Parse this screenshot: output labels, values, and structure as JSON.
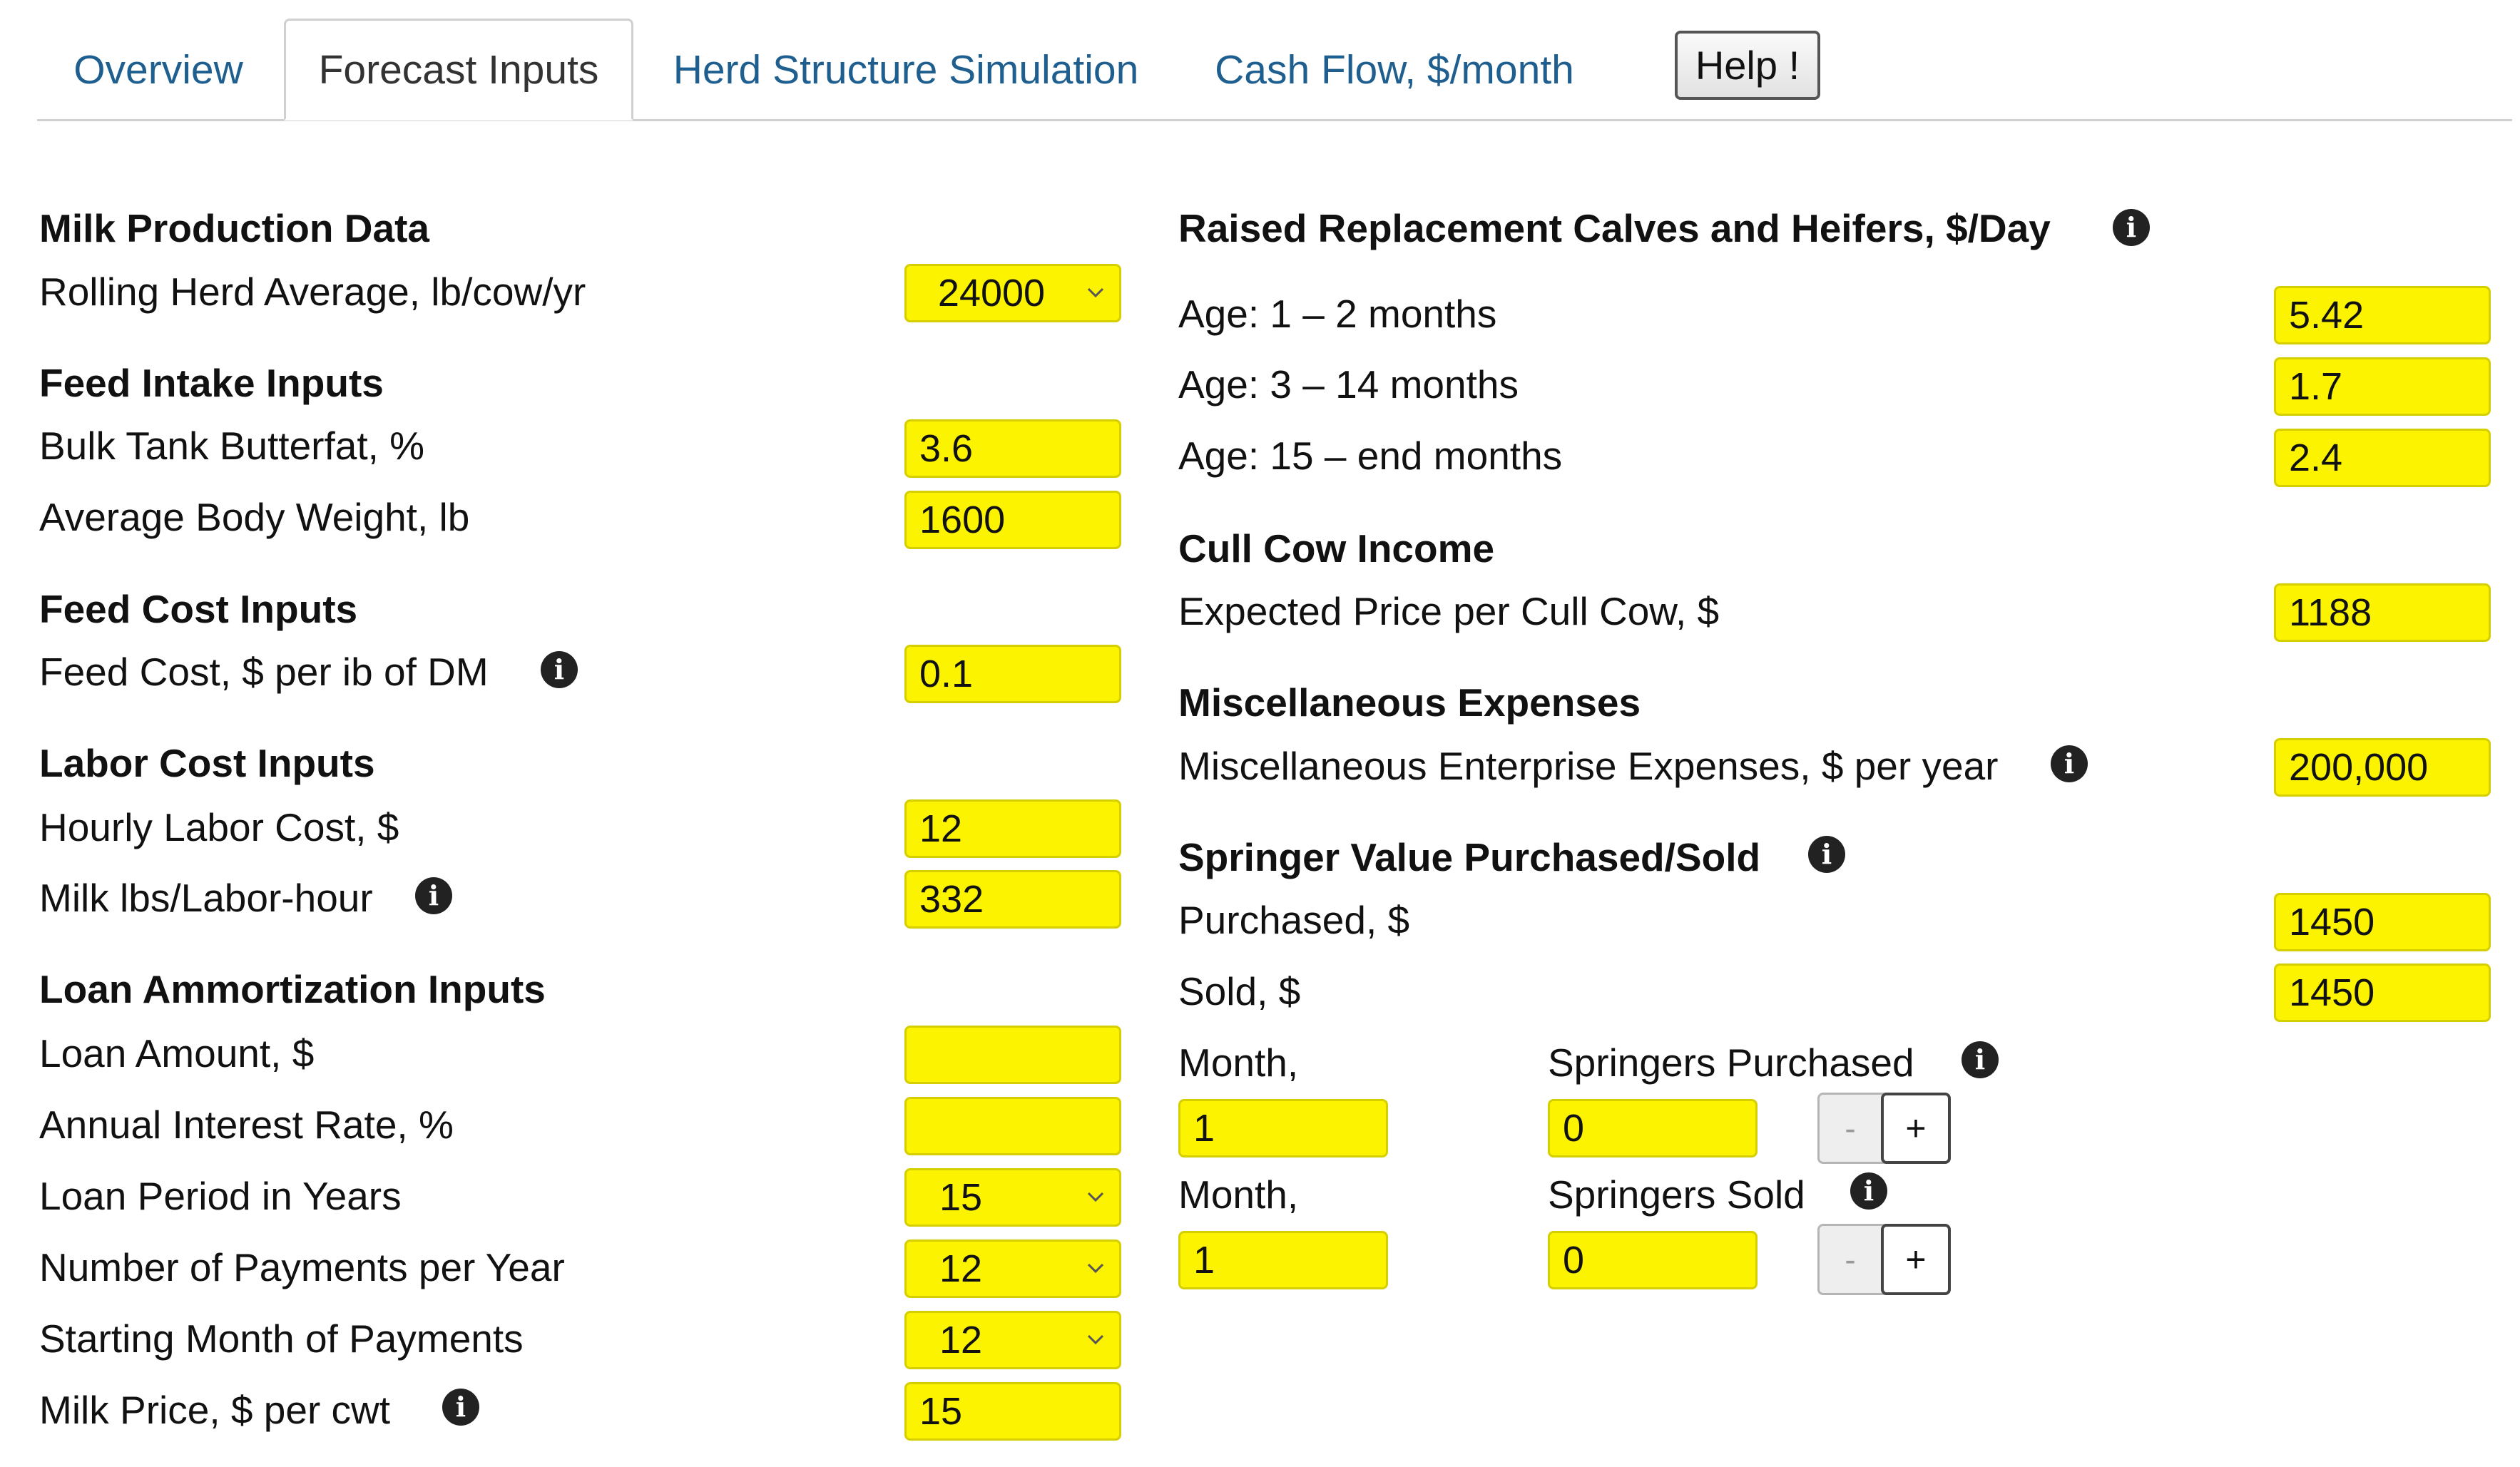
{
  "tabs": [
    {
      "label": "Overview",
      "active": false
    },
    {
      "label": "Forecast Inputs",
      "active": true
    },
    {
      "label": "Herd Structure Simulation",
      "active": false
    },
    {
      "label": "Cash Flow, $/month",
      "active": false
    }
  ],
  "help_label": "Help !",
  "left": {
    "milk_production": {
      "heading": "Milk Production Data",
      "rha_label": "Rolling Herd Average, lb/cow/yr",
      "rha_value": "24000"
    },
    "feed_intake": {
      "heading": "Feed Intake Inputs",
      "butterfat_label": "Bulk Tank Butterfat, %",
      "butterfat_value": "3.6",
      "bodyweight_label": "Average Body Weight, lb",
      "bodyweight_value": "1600"
    },
    "feed_cost": {
      "heading": "Feed Cost Inputs",
      "feed_cost_label": "Feed Cost, $ per ib of DM",
      "feed_cost_value": "0.1"
    },
    "labor_cost": {
      "heading": "Labor Cost Inputs",
      "hourly_label": "Hourly Labor Cost, $",
      "hourly_value": "12",
      "milk_lbs_label": "Milk lbs/Labor-hour",
      "milk_lbs_value": "332"
    },
    "loan": {
      "heading": "Loan Ammortization Inputs",
      "amount_label": "Loan Amount, $",
      "amount_value": "",
      "rate_label": "Annual Interest Rate, %",
      "rate_value": "",
      "period_label": "Loan Period in Years",
      "period_value": "15",
      "payments_label": "Number of Payments per Year",
      "payments_value": "12",
      "start_label": "Starting Month of Payments",
      "start_value": "12",
      "milk_price_label": "Milk Price, $ per cwt",
      "milk_price_value": "15"
    }
  },
  "right": {
    "replacement": {
      "heading": "Raised Replacement Calves and Heifers, $/Day",
      "age1_label": "Age: 1 – 2 months",
      "age1_value": "5.42",
      "age2_label": "Age: 3 – 14 months",
      "age2_value": "1.7",
      "age3_label": "Age: 15 – end months",
      "age3_value": "2.4"
    },
    "cull": {
      "heading": "Cull Cow Income",
      "price_label": "Expected Price per Cull Cow, $",
      "price_value": "1188"
    },
    "misc": {
      "heading": "Miscellaneous Expenses",
      "label": "Miscellaneous Enterprise Expenses, $ per year",
      "value": "200,000"
    },
    "springer": {
      "heading": "Springer Value Purchased/Sold",
      "purchased_label": "Purchased, $",
      "purchased_value": "1450",
      "sold_label": "Sold, $",
      "sold_value": "1450",
      "month_label_1": "Month,",
      "purchased_count_label": "Springers Purchased",
      "month_value_1": "1",
      "purchased_count_value": "0",
      "month_label_2": "Month,",
      "sold_count_label": "Springers Sold",
      "month_value_2": "1",
      "sold_count_value": "0",
      "minus": "-",
      "plus": "+"
    }
  },
  "colors": {
    "input_bg": "#fbf300",
    "tab_link": "#1f5f8f"
  },
  "icons": {
    "info": "info-circle-icon",
    "dropdown": "chevron-down-icon"
  }
}
